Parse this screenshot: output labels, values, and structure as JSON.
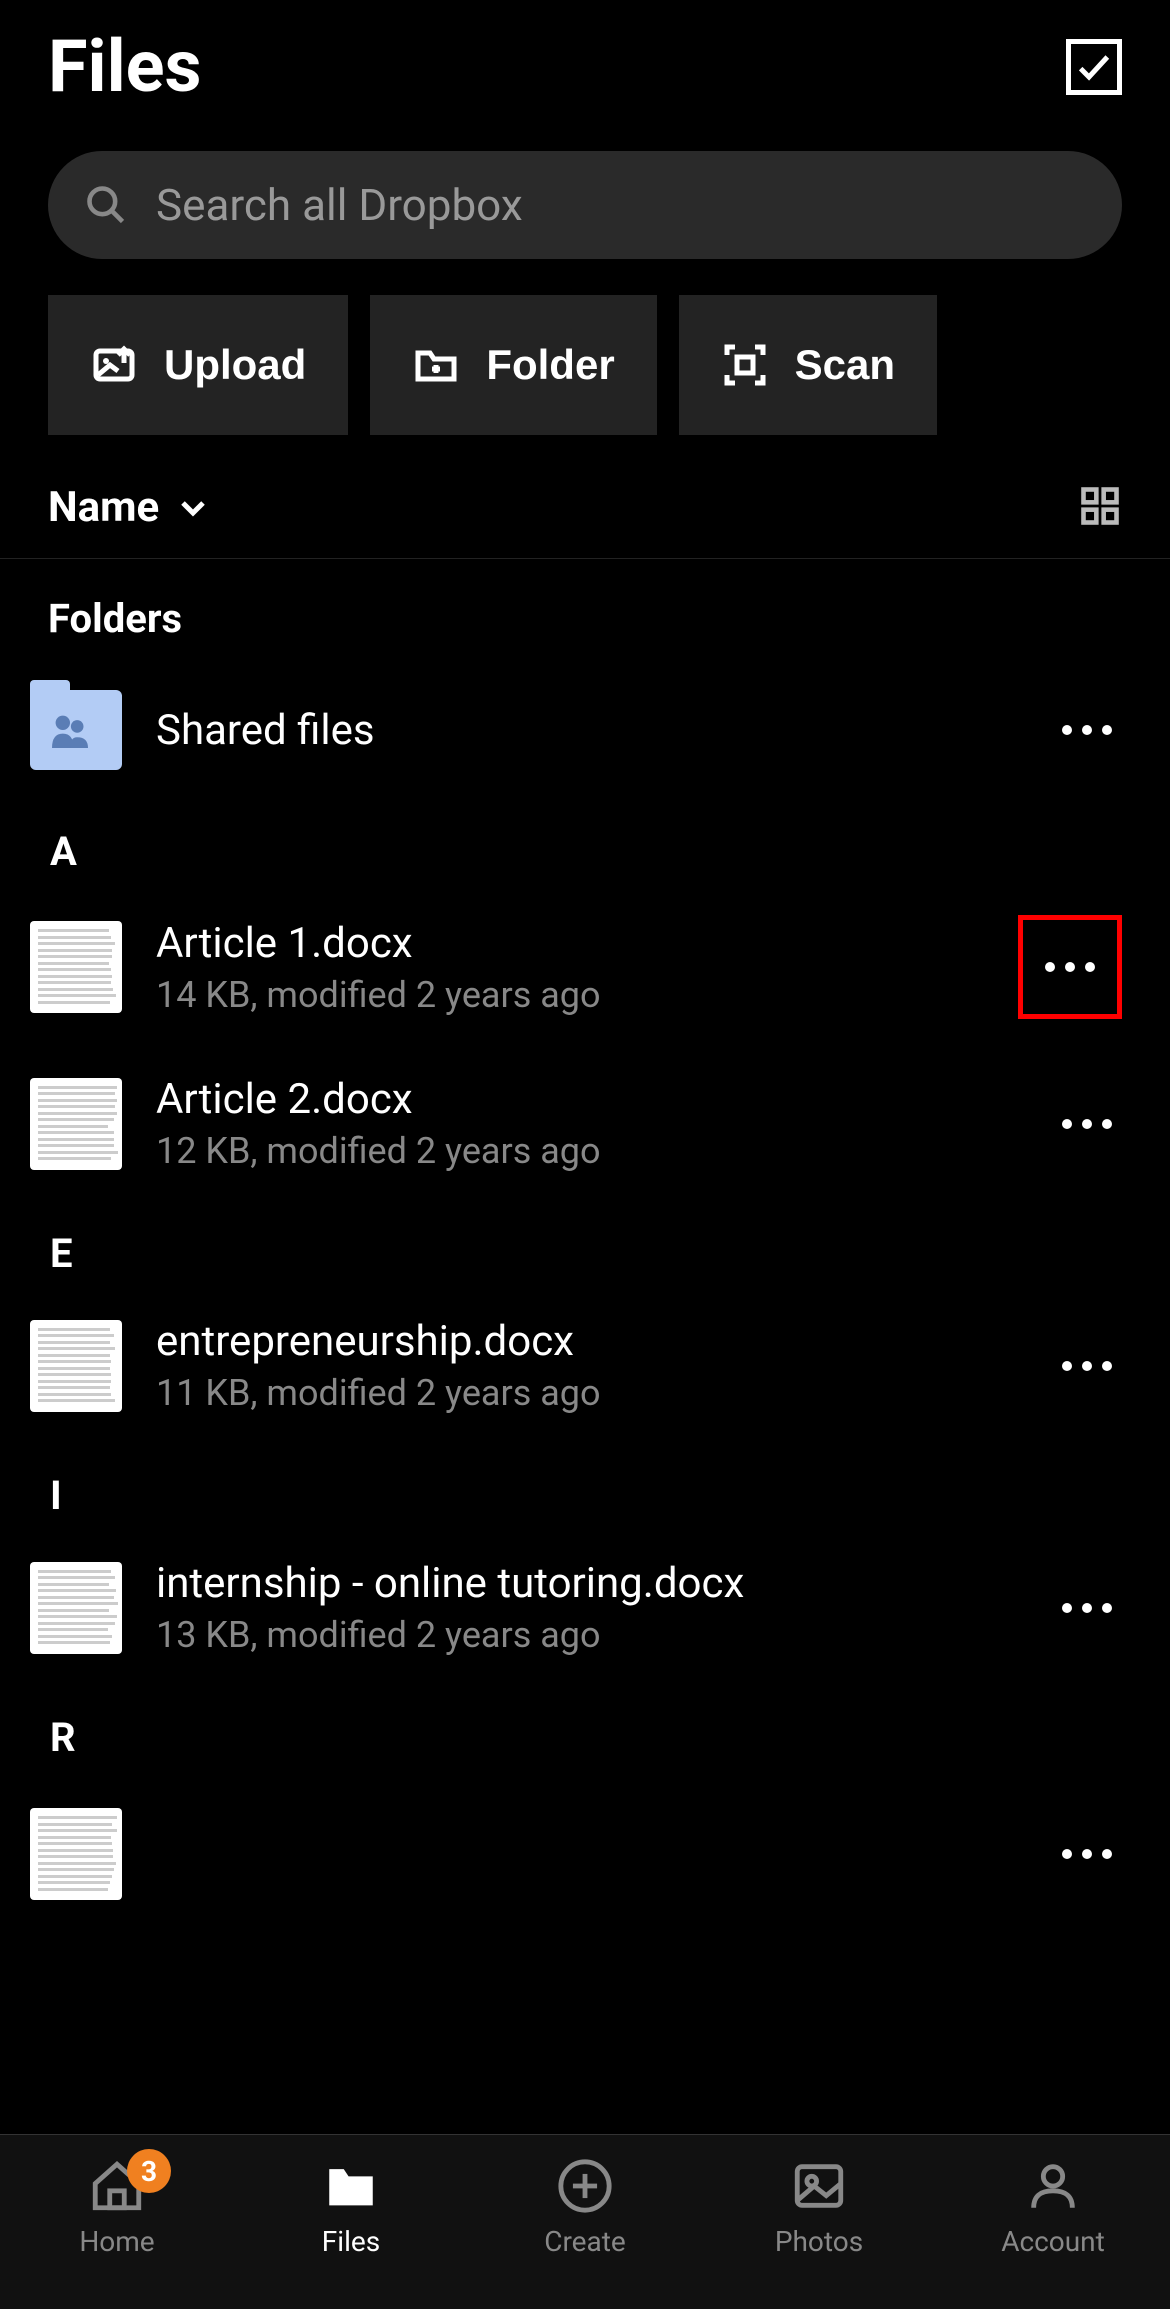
{
  "header": {
    "title": "Files"
  },
  "search": {
    "placeholder": "Search all Dropbox"
  },
  "actions": {
    "upload": "Upload",
    "folder": "Folder",
    "scan": "Scan"
  },
  "sort": {
    "label": "Name"
  },
  "sections": {
    "folders_label": "Folders",
    "folders": [
      {
        "name": "Shared files"
      }
    ],
    "letters": [
      {
        "letter": "A",
        "files": [
          {
            "name": "Article 1.docx",
            "meta": "14 KB, modified 2 years ago",
            "highlight": true
          },
          {
            "name": "Article 2.docx",
            "meta": "12 KB, modified 2 years ago"
          }
        ]
      },
      {
        "letter": "E",
        "files": [
          {
            "name": "entrepreneurship.docx",
            "meta": "11 KB, modified 2 years ago"
          }
        ]
      },
      {
        "letter": "I",
        "files": [
          {
            "name": "internship - online tutoring.docx",
            "meta": "13 KB, modified 2 years ago"
          }
        ]
      },
      {
        "letter": "R",
        "files": [
          {
            "name": "",
            "meta": "",
            "redacted": true
          }
        ]
      }
    ]
  },
  "tabs": {
    "home": "Home",
    "files": "Files",
    "create": "Create",
    "photos": "Photos",
    "account": "Account",
    "home_badge": "3"
  }
}
